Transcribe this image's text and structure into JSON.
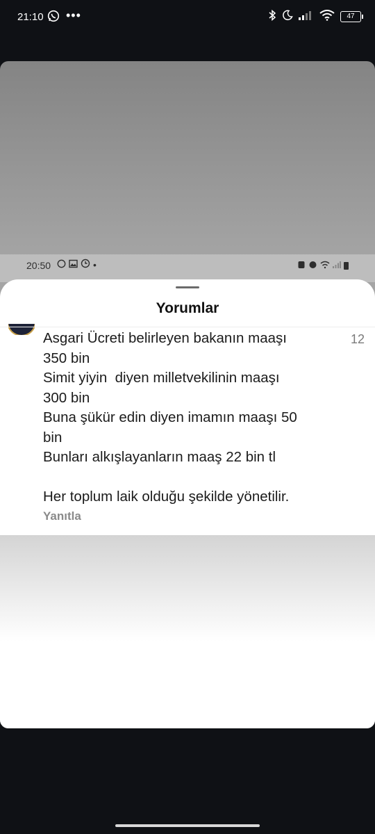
{
  "status_bar": {
    "time": "21:10",
    "dots": "•••",
    "battery": "47"
  },
  "screenshot": {
    "status_bar": {
      "time": "20:50",
      "dot": "•"
    },
    "sheet": {
      "title": "Yorumlar",
      "comment": {
        "text": "Asgari Ücreti belirleyen bakanın maaşı\n350 bin\nSimit yiyin  diyen milletvekilinin maaşı\n300 bin\nBuna şükür edin diyen imamın maaşı 50\nbin\nBunları alkışlayanların maaş 22 bin tl\n\nHer toplum laik olduğu şekilde yönetilir.",
        "likes": "12",
        "reply_label": "Yanıtla"
      }
    }
  },
  "colors": {
    "background": "#0f1115",
    "sheet": "#ffffff",
    "reply": "#8a8a8a"
  }
}
